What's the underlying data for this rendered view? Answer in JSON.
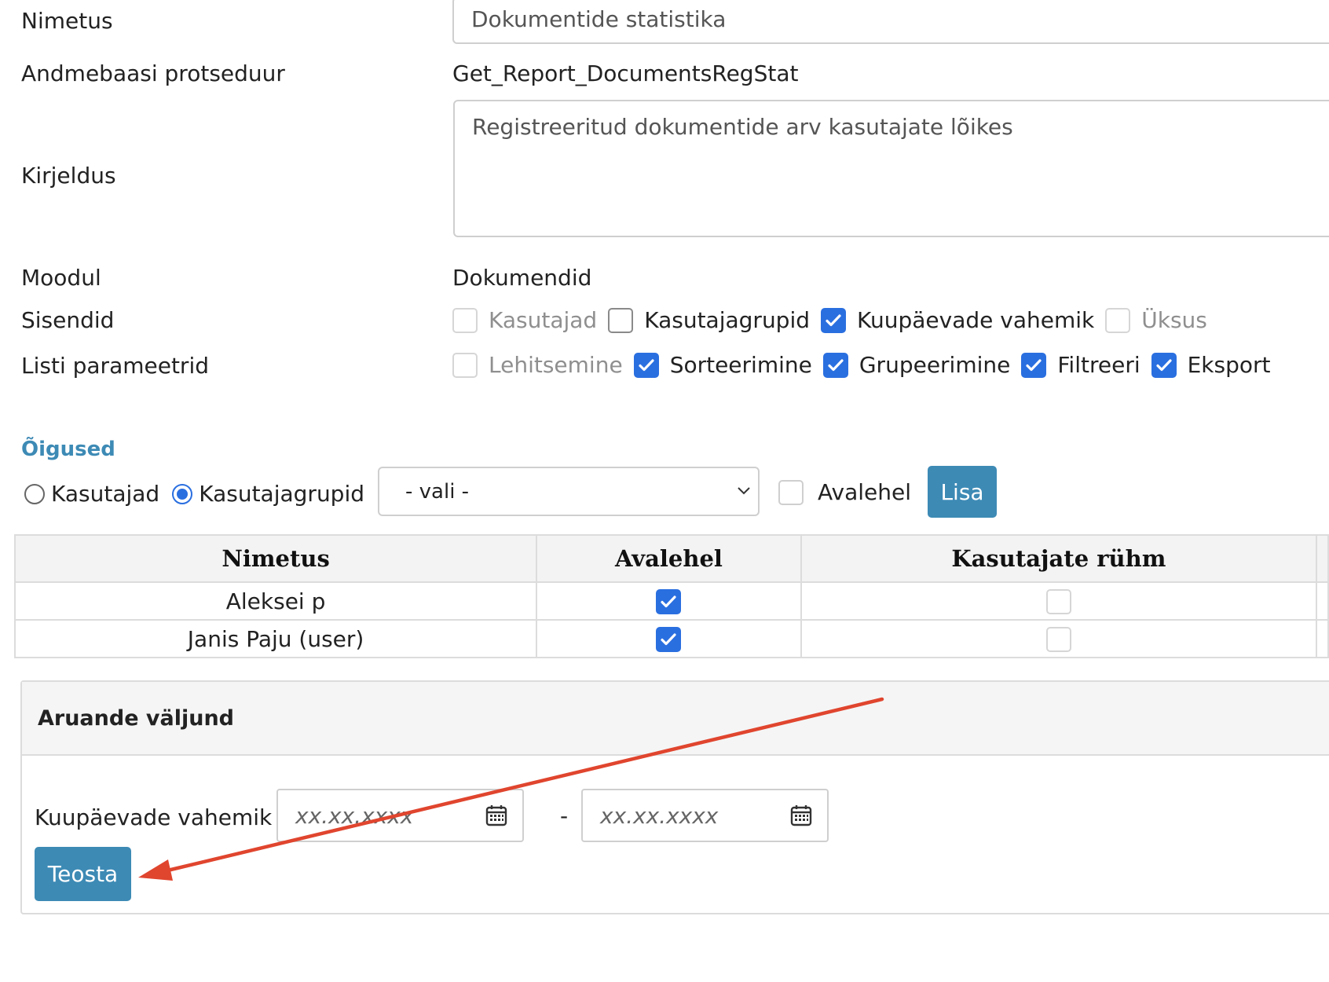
{
  "form": {
    "name_label": "Nimetus",
    "name_value": "Dokumentide statistika",
    "procedure_label": "Andmebaasi protseduur",
    "procedure_value": "Get_Report_DocumentsRegStat",
    "description_label": "Kirjeldus",
    "description_value": "Registreeritud dokumentide arv kasutajate lõikes",
    "module_label": "Moodul",
    "module_value": "Dokumendid",
    "inputs_label": "Sisendid",
    "inputs": [
      {
        "label": "Kasutajad",
        "checked": false,
        "disabled": true
      },
      {
        "label": "Kasutajagrupid",
        "checked": false,
        "disabled": false
      },
      {
        "label": "Kuupäevade vahemik",
        "checked": true,
        "disabled": false
      },
      {
        "label": "Üksus",
        "checked": false,
        "disabled": true
      }
    ],
    "list_params_label": "Listi parameetrid",
    "list_params": [
      {
        "label": "Lehitsemine",
        "checked": false,
        "disabled": true
      },
      {
        "label": "Sorteerimine",
        "checked": true,
        "disabled": false
      },
      {
        "label": "Grupeerimine",
        "checked": true,
        "disabled": false
      },
      {
        "label": "Filtreeri",
        "checked": true,
        "disabled": false
      },
      {
        "label": "Eksport",
        "checked": true,
        "disabled": false
      }
    ]
  },
  "rights": {
    "heading": "Õigused",
    "radio_users": "Kasutajad",
    "radio_groups": "Kasutajagrupid",
    "selected_radio": "Kasutajagrupid",
    "select_value": "- vali -",
    "frontpage_label": "Avalehel",
    "add_button": "Lisa",
    "table": {
      "headers": [
        "Nimetus",
        "Avalehel",
        "Kasutajate rühm"
      ],
      "rows": [
        {
          "name": "Aleksei p",
          "frontpage": true,
          "group": false
        },
        {
          "name": "Janis Paju (user)",
          "frontpage": true,
          "group": false
        }
      ]
    }
  },
  "output": {
    "heading": "Aruande väljund",
    "date_range_label": "Kuupäevade vahemik",
    "date_from_placeholder": "xx.xx.xxxx",
    "date_to_placeholder": "xx.xx.xxxx",
    "separator": "-",
    "run_button": "Teosta"
  },
  "colors": {
    "accent": "#3d8ab5",
    "checkbox": "#2a6fe0",
    "heading_link": "#3d8ab5",
    "annotation_arrow": "#e0452e"
  },
  "icons": [
    "calendar-icon",
    "chevron-down-icon",
    "checkmark-icon"
  ]
}
